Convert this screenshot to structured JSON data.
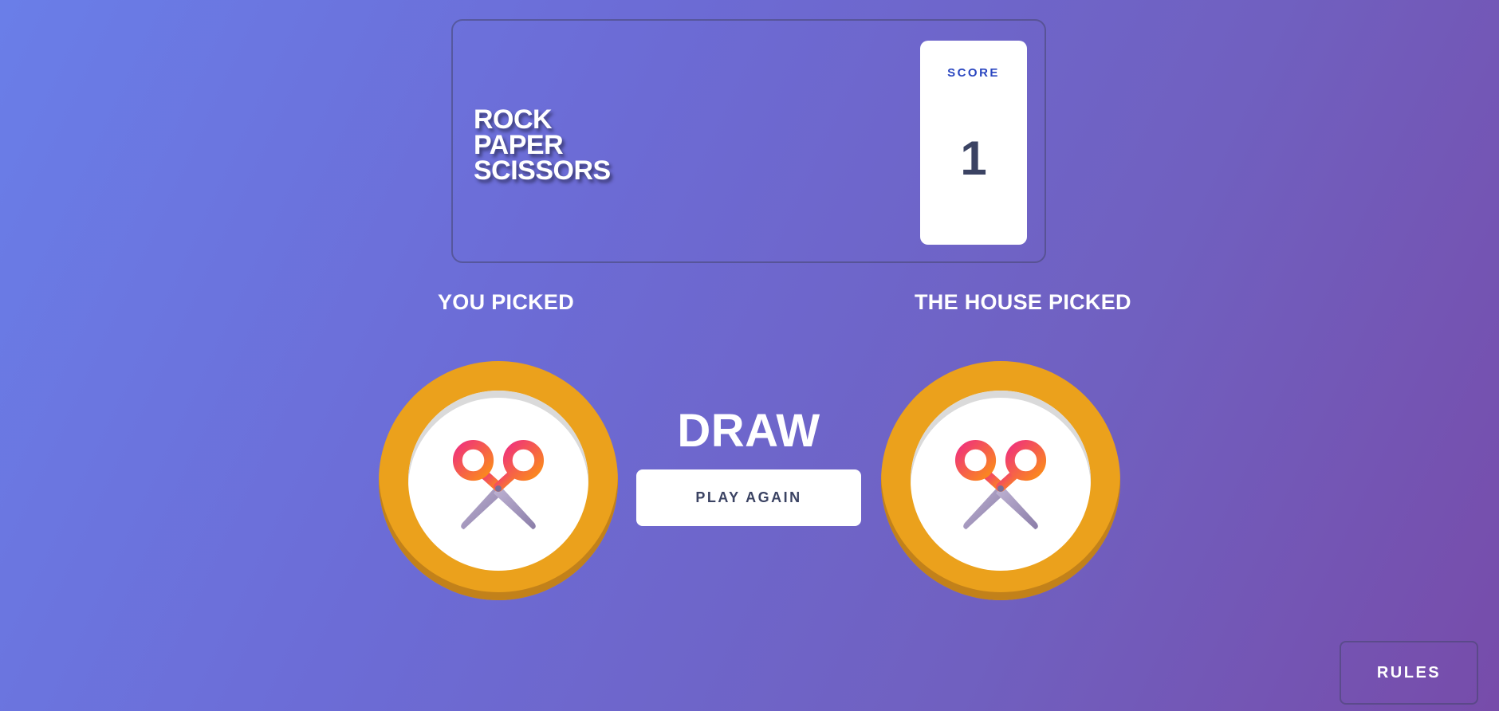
{
  "header": {
    "title_lines": [
      "ROCK",
      "PAPER",
      "SCISSORS"
    ],
    "score_label": "SCORE",
    "score_value": "1"
  },
  "picks": {
    "you_label": "YOU PICKED",
    "house_label": "THE HOUSE PICKED",
    "you_choice_icon": "scissors-icon",
    "house_choice_icon": "scissors-icon"
  },
  "result": {
    "text": "DRAW",
    "play_again_label": "PLAY AGAIN"
  },
  "footer": {
    "rules_label": "RULES"
  },
  "colors": {
    "background_start": "#6a7ee8",
    "background_end": "#774caa",
    "scissors_ring": "#eba11c",
    "scissors_ring_shadow": "#c2811a",
    "score_label": "#2a46c0",
    "dark_text": "#3b4363"
  }
}
